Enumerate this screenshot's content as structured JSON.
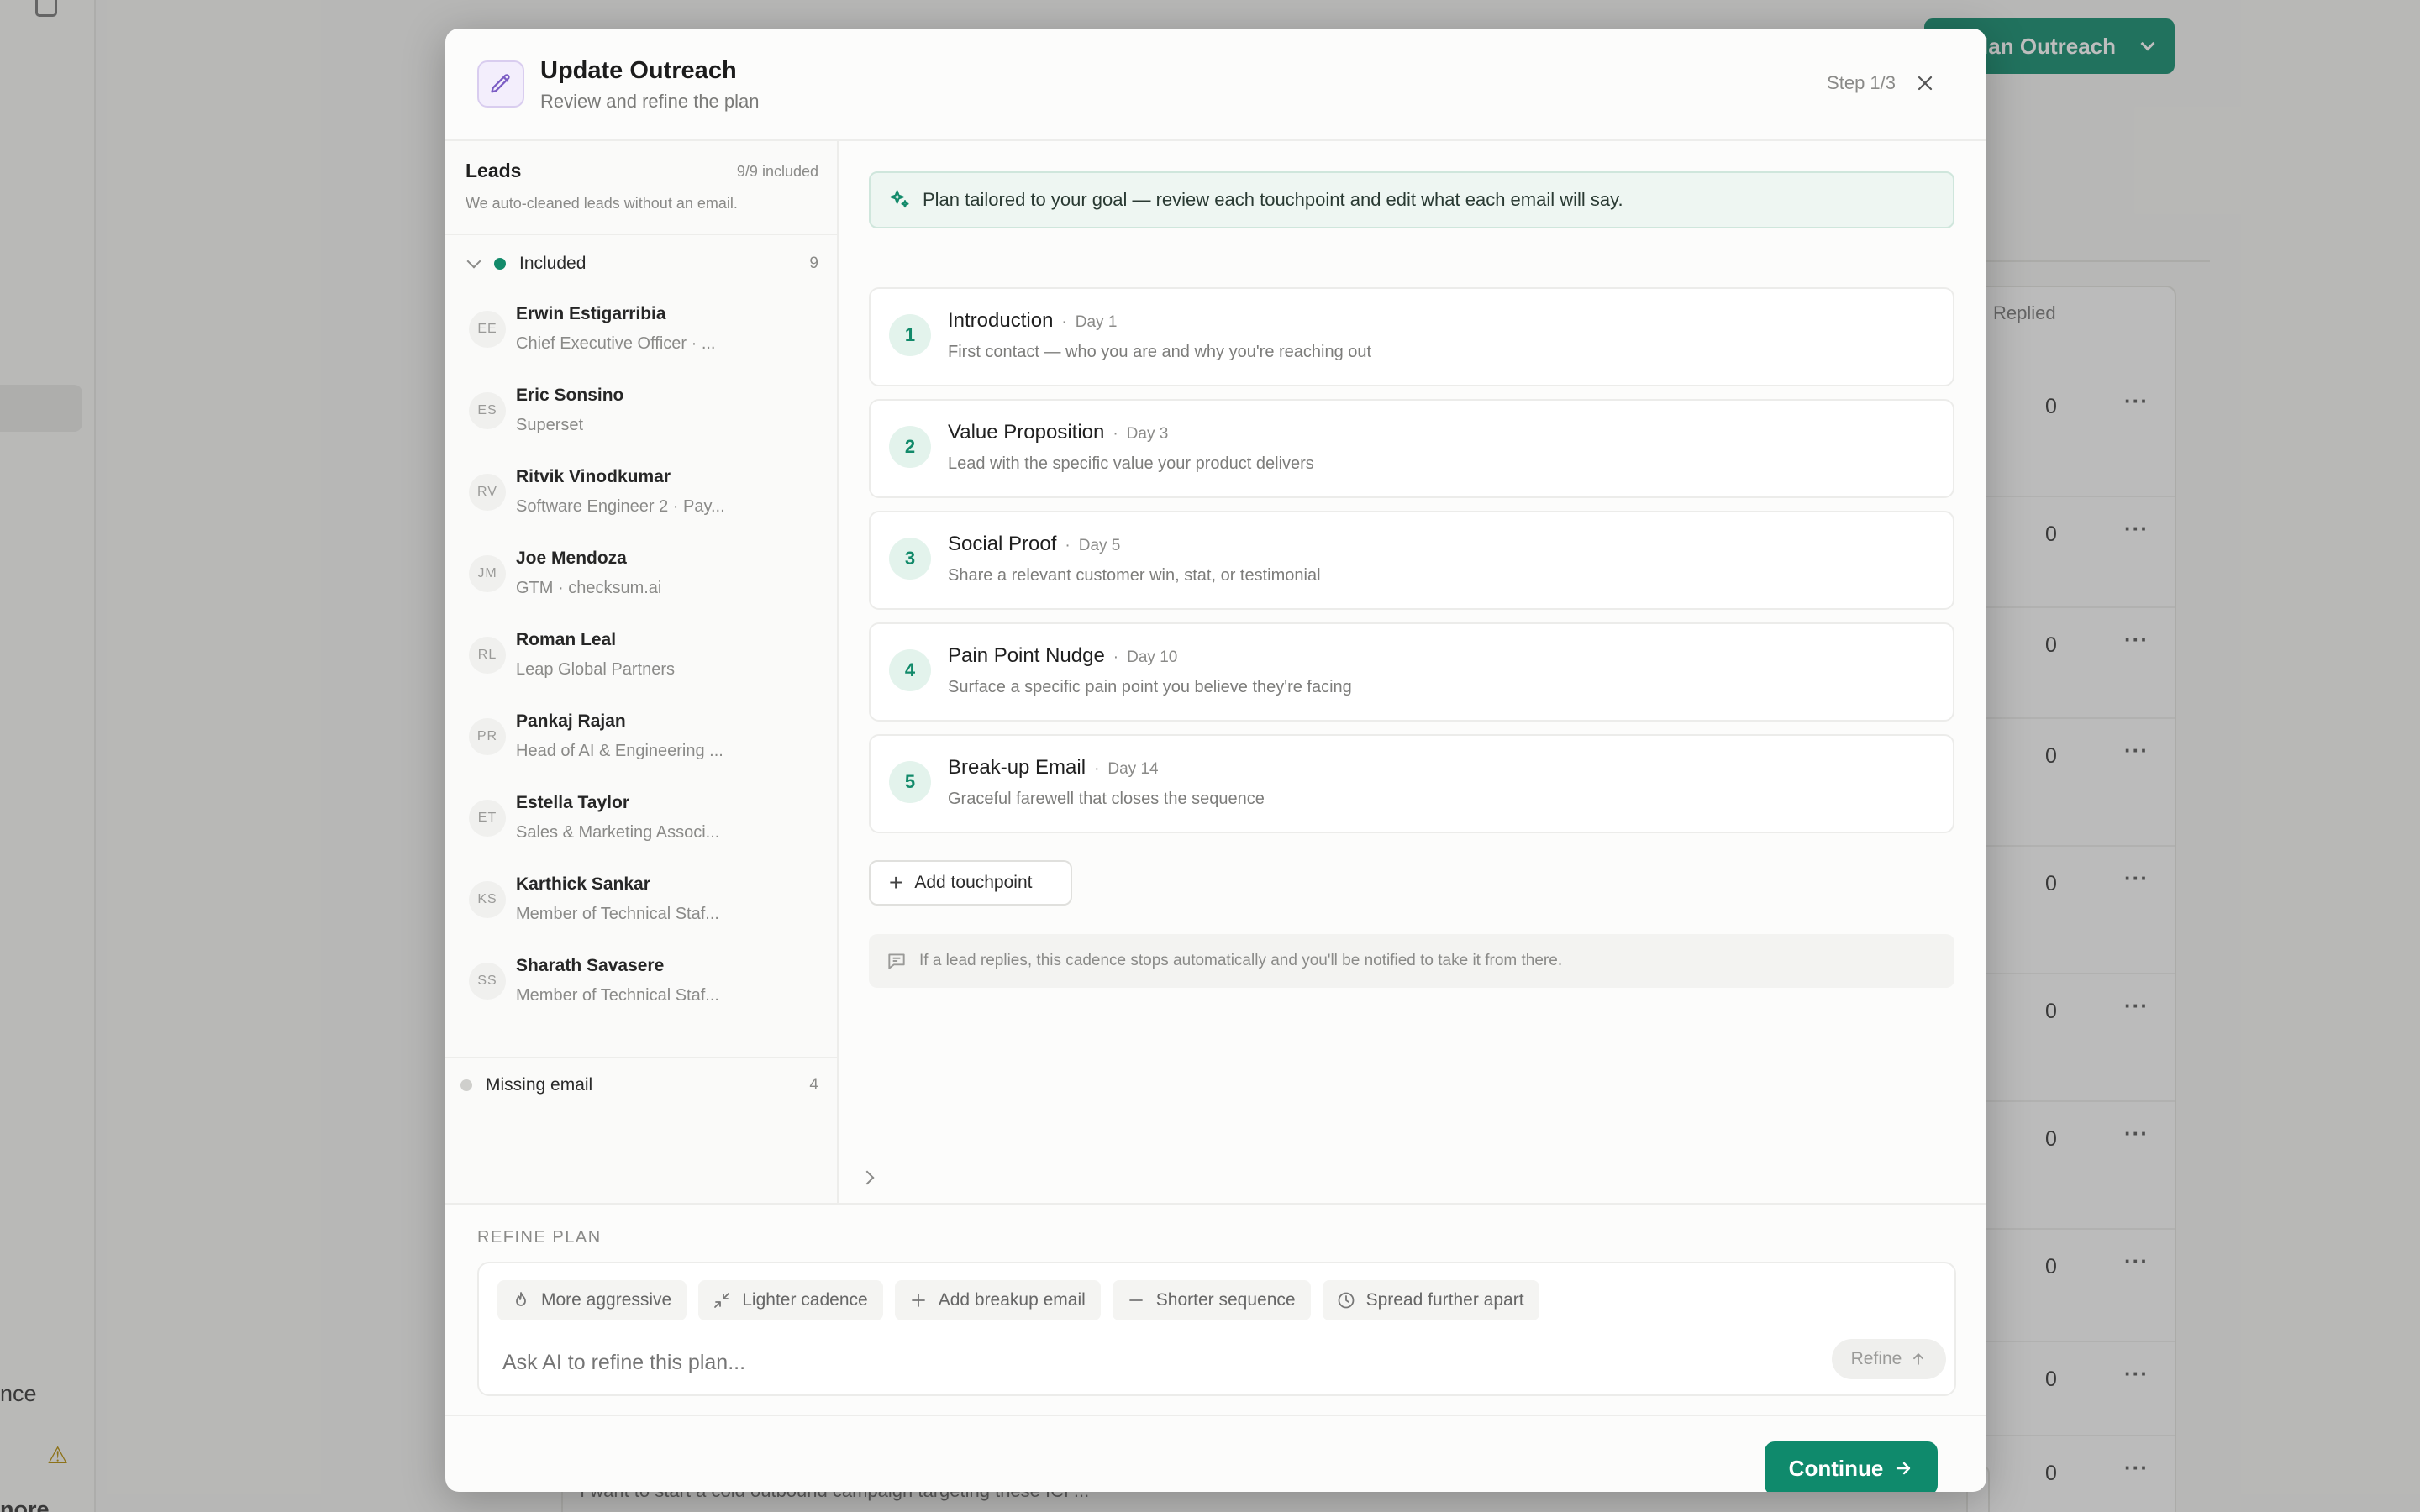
{
  "background": {
    "plan_button_label": "Plan Outreach",
    "table_header": "Replied",
    "table_values": [
      "0",
      "0",
      "0",
      "0",
      "0",
      "0",
      "0",
      "0",
      "0",
      "0"
    ],
    "sidebar_text_1": "nce",
    "sidebar_text_2": "nore",
    "bottom_text": "I want to start a cold outbound campaign targeting these ICP..."
  },
  "modal": {
    "title": "Update Outreach",
    "subtitle": "Review and refine the plan",
    "step": "Step 1/3",
    "icons": {
      "header": "pencil-icon",
      "close": "close-icon"
    }
  },
  "leads": {
    "heading": "Leads",
    "count": "9/9 included",
    "note": "We auto-cleaned leads without an email.",
    "included_group": {
      "label": "Included",
      "count": "9",
      "dot_color": "#128a6a"
    },
    "missing_group": {
      "label": "Missing email",
      "count": "4",
      "dot_color": "#cfcfcc"
    },
    "items": [
      {
        "initials": "EE",
        "name": "Erwin Estigarribia",
        "subtitle": "Chief Executive Officer · ..."
      },
      {
        "initials": "ES",
        "name": "Eric Sonsino",
        "subtitle": "Superset"
      },
      {
        "initials": "RV",
        "name": "Ritvik Vinodkumar",
        "subtitle": "Software Engineer 2 · Pay..."
      },
      {
        "initials": "JM",
        "name": "Joe Mendoza",
        "subtitle": "GTM · checksum.ai"
      },
      {
        "initials": "RL",
        "name": "Roman Leal",
        "subtitle": "Leap Global Partners"
      },
      {
        "initials": "PR",
        "name": "Pankaj Rajan",
        "subtitle": "Head of AI & Engineering ..."
      },
      {
        "initials": "ET",
        "name": "Estella Taylor",
        "subtitle": "Sales & Marketing Associ..."
      },
      {
        "initials": "KS",
        "name": "Karthick Sankar",
        "subtitle": "Member of Technical Staf..."
      },
      {
        "initials": "SS",
        "name": "Sharath Savasere",
        "subtitle": "Member of Technical Staf..."
      }
    ]
  },
  "plan": {
    "banner": "Plan tailored to your goal — review each touchpoint and edit what each email will say.",
    "touchpoints": [
      {
        "number": "1",
        "title": "Introduction",
        "day": "Day 1",
        "description": "First contact — who you are and why you're reaching out"
      },
      {
        "number": "2",
        "title": "Value Proposition",
        "day": "Day 3",
        "description": "Lead with the specific value your product delivers"
      },
      {
        "number": "3",
        "title": "Social Proof",
        "day": "Day 5",
        "description": "Share a relevant customer win, stat, or testimonial"
      },
      {
        "number": "4",
        "title": "Pain Point Nudge",
        "day": "Day 10",
        "description": "Surface a specific pain point you believe they're facing"
      },
      {
        "number": "5",
        "title": "Break-up Email",
        "day": "Day 14",
        "description": "Graceful farewell that closes the sequence"
      }
    ],
    "separator": "·",
    "add_touchpoint_label": "Add touchpoint",
    "note": "If a lead replies, this cadence stops automatically and you'll be notified to take it from there."
  },
  "refine": {
    "label": "REFINE PLAN",
    "chips": [
      {
        "label": "More aggressive",
        "icon": "flame-icon"
      },
      {
        "label": "Lighter cadence",
        "icon": "minimize-icon"
      },
      {
        "label": "Add breakup email",
        "icon": "plus-icon"
      },
      {
        "label": "Shorter sequence",
        "icon": "minus-icon"
      },
      {
        "label": "Spread further apart",
        "icon": "clock-icon"
      }
    ],
    "input_placeholder": "Ask AI to refine this plan...",
    "button_label": "Refine"
  },
  "footer": {
    "continue_label": "Continue"
  },
  "colors": {
    "accent": "#0f8a6c",
    "accent_soft": "#e3f3ec",
    "banner_bg": "#eef6f2"
  }
}
